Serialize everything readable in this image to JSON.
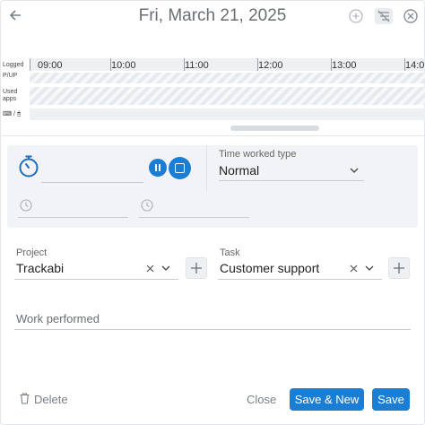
{
  "header": {
    "title": "Fri, March 21, 2025",
    "icons": [
      "back-arrow-icon",
      "add-circle-icon",
      "list-icon",
      "close-circle-icon"
    ]
  },
  "timeline": {
    "rows": {
      "logged": "Logged",
      "pup": "P/UP",
      "used_line1": "Used",
      "used_line2": "apps",
      "devices": "⌨ / 🖱"
    },
    "hours": [
      "09:00",
      "10:00",
      "11:00",
      "12:00",
      "13:00",
      "14:0"
    ]
  },
  "timer": {
    "value": "",
    "time_worked_type_label": "Time worked type",
    "time_worked_type_value": "Normal",
    "start_time": "",
    "end_time": ""
  },
  "project": {
    "label": "Project",
    "value": "Trackabi"
  },
  "task": {
    "label": "Task",
    "value": "Customer support"
  },
  "work_performed": {
    "placeholder": "Work performed"
  },
  "footer": {
    "delete_label": "Delete",
    "close_label": "Close",
    "save_new_label": "Save & New",
    "save_label": "Save"
  },
  "colors": {
    "primary": "#1a7fd4",
    "panel_bg": "#f1f3f6",
    "muted_text": "#7a8088"
  }
}
